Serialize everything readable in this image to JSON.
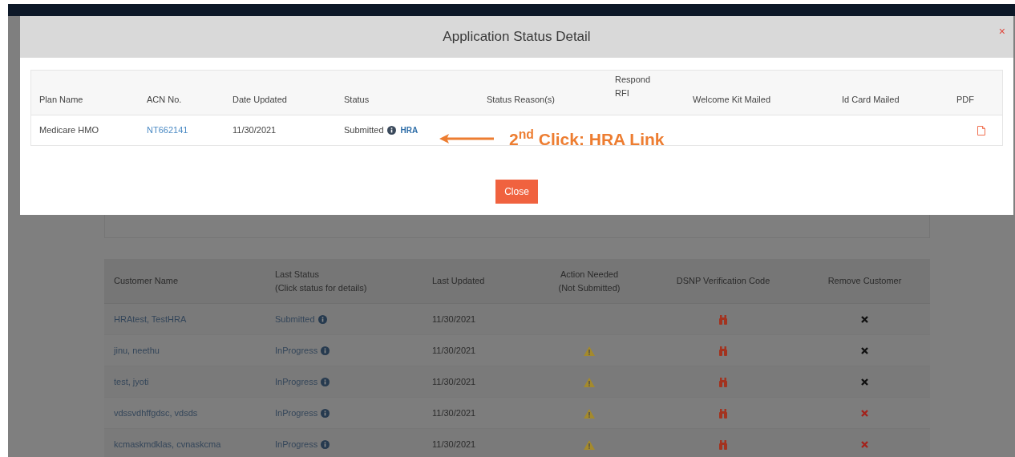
{
  "modal": {
    "title": "Application Status Detail",
    "close_icon": "×",
    "columns": [
      {
        "lines": [
          "Plan Name"
        ]
      },
      {
        "lines": [
          "ACN No."
        ]
      },
      {
        "lines": [
          "Date Updated"
        ]
      },
      {
        "lines": [
          "Status"
        ]
      },
      {
        "lines": [
          "Status Reason(s)"
        ]
      },
      {
        "lines": [
          "Respond",
          "RFI"
        ]
      },
      {
        "lines": [
          "Welcome Kit Mailed"
        ]
      },
      {
        "lines": [
          "Id Card Mailed"
        ]
      },
      {
        "lines": [
          "PDF"
        ]
      }
    ],
    "rows": [
      {
        "plan_name": "Medicare HMO",
        "acn": "NT662141",
        "date_updated": "11/30/2021",
        "status": "Submitted",
        "status_link": "HRA"
      }
    ],
    "close_button": "Close"
  },
  "annotation": {
    "text": "2$^{nd}$ Click: HRA Link"
  },
  "customers": {
    "columns": [
      {
        "lines": [
          "Customer Name"
        ]
      },
      {
        "lines": [
          "Last Status",
          "(Click status for details)"
        ]
      },
      {
        "lines": [
          "Last Updated"
        ]
      },
      {
        "lines": [
          "Action Needed",
          "(Not Submitted)"
        ]
      },
      {
        "lines": [
          "DSNP Verification Code"
        ]
      },
      {
        "lines": [
          "Remove Customer"
        ]
      }
    ],
    "rows": [
      {
        "name": "HRAtest, TestHRA",
        "status": "Submitted",
        "updated": "11/30/2021",
        "action_needed": false,
        "color": "#111111"
      },
      {
        "name": "jinu, neethu",
        "status": "InProgress",
        "updated": "11/30/2021",
        "action_needed": true,
        "color": "#111111"
      },
      {
        "name": "test, jyoti",
        "status": "InProgress",
        "updated": "11/30/2021",
        "action_needed": true,
        "color": "#111111"
      },
      {
        "name": "vdssvdhffgdsc, vdsds",
        "status": "InProgress",
        "updated": "11/30/2021",
        "action_needed": true,
        "color": "#a3221b"
      },
      {
        "name": "kcmaskmdklas, cvnaskcma",
        "status": "InProgress",
        "updated": "11/30/2021",
        "action_needed": true,
        "color": "#a3221b"
      }
    ]
  }
}
